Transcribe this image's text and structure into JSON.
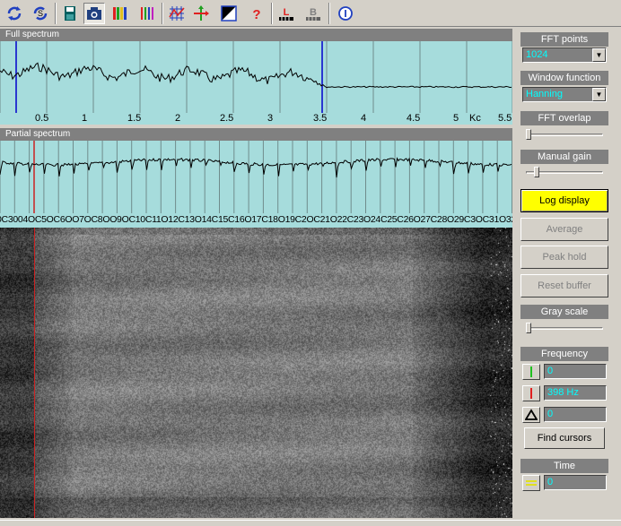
{
  "toolbar": {
    "buttons": [
      {
        "icon": "refresh-icon"
      },
      {
        "icon": "rotate-s-icon",
        "label": "S"
      },
      {
        "icon": "save-icon"
      },
      {
        "icon": "camera-icon"
      },
      {
        "icon": "color-bars-icon"
      },
      {
        "icon": "vertical-lines-icon"
      },
      {
        "icon": "grid-icon"
      },
      {
        "icon": "cursor-arrows-icon"
      },
      {
        "icon": "contrast-icon"
      },
      {
        "icon": "help-icon",
        "label": "?"
      },
      {
        "icon": "marker-l-icon",
        "label": "L"
      },
      {
        "icon": "marker-b-icon",
        "label": "B"
      },
      {
        "icon": "info-icon"
      }
    ]
  },
  "full_spectrum": {
    "title": "Full spectrum",
    "axis_labels": [
      "0.5",
      "1",
      "1.5",
      "2",
      "2.5",
      "3",
      "3.5",
      "4",
      "4.5",
      "5",
      "Kc",
      "5.5"
    ]
  },
  "partial_spectrum": {
    "title": "Partial spectrum",
    "axis_text": "0C3004OC5OC6OO7OC8OO9OC10C11O12C13O14C15C16O17C18O19C2OC21O22C23O24C25C26O27C28O29C3OC31O32C33O34C3"
  },
  "right_panel": {
    "fft_points": {
      "label": "FFT points",
      "value": "1024"
    },
    "window_function": {
      "label": "Window function",
      "value": "Hanning"
    },
    "fft_overlap": {
      "label": "FFT overlap",
      "value": 0.0
    },
    "manual_gain": {
      "label": "Manual gain",
      "value": 0.1
    },
    "log_display": "Log display",
    "average": "Average",
    "peak_hold": "Peak hold",
    "reset_buffer": "Reset buffer",
    "gray_scale": {
      "label": "Gray scale",
      "value": 0.0
    },
    "frequency": {
      "label": "Frequency",
      "green_cursor": "0",
      "red_cursor": "398 Hz",
      "delta": "0",
      "find_cursors": "Find cursors"
    },
    "time": {
      "label": "Time",
      "value": "0"
    }
  },
  "colors": {
    "plot_bg": "#a6dcdc",
    "cursor_blue": "#0000cc",
    "cursor_red": "#cc2222",
    "field_text": "#00ffff",
    "active_button": "#ffff00"
  }
}
